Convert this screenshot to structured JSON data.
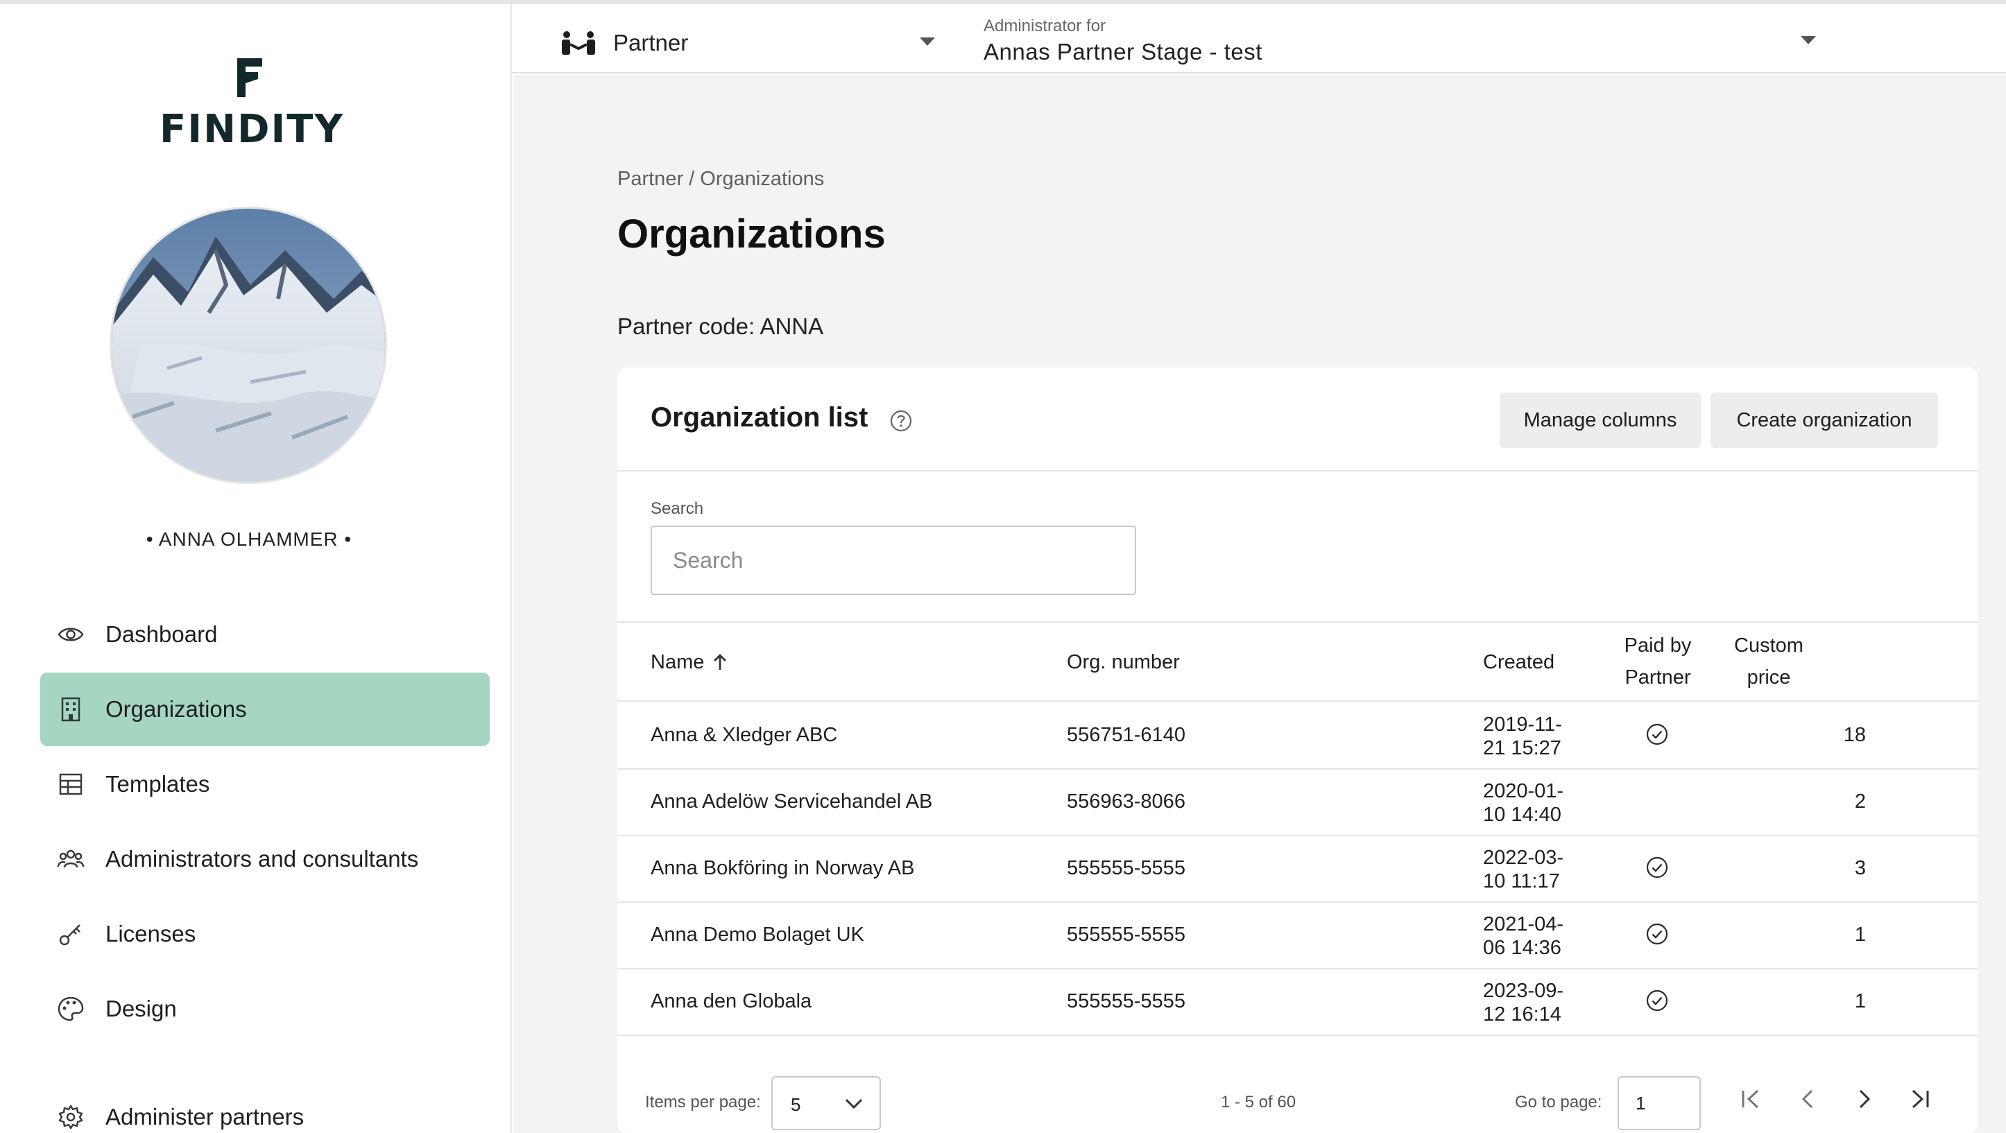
{
  "topbar": {
    "partner_label": "Partner",
    "admin_label": "Administrator for",
    "admin_value": "Annas Partner Stage - test"
  },
  "sidebar": {
    "logo_text": "FINDITY",
    "user_name": "• ANNA OLHAMMER •",
    "items": [
      {
        "label": "Dashboard",
        "icon": "eye-icon"
      },
      {
        "label": "Organizations",
        "icon": "building-icon",
        "active": true
      },
      {
        "label": "Templates",
        "icon": "table-icon"
      },
      {
        "label": "Administrators and consultants",
        "icon": "users-icon"
      },
      {
        "label": "Licenses",
        "icon": "key-icon"
      },
      {
        "label": "Design",
        "icon": "palette-icon"
      },
      {
        "label": "Administer partners",
        "icon": "gear-icon"
      }
    ],
    "active_color": "#a5d6c2"
  },
  "breadcrumb": {
    "root": "Partner",
    "separator": " / ",
    "current": "Organizations"
  },
  "page": {
    "title": "Organizations",
    "partner_code": "Partner code: ANNA"
  },
  "card": {
    "title": "Organization list",
    "manage_columns": "Manage columns",
    "create_organization": "Create organization",
    "search_label": "Search",
    "search_placeholder": "Search",
    "search_value": ""
  },
  "table": {
    "columns": {
      "name": "Name",
      "org_number": "Org. number",
      "created": "Created",
      "paid_by_partner_1": "Paid by",
      "paid_by_partner_2": "Partner",
      "custom_price_1": "Custom",
      "custom_price_2": "price"
    },
    "sort": {
      "column": "Name",
      "direction": "ascending"
    },
    "rows": [
      {
        "name": "Anna & Xledger ABC",
        "org": "556751-6140",
        "created_1": "2019-11-",
        "created_2": "21 15:27",
        "paid": true,
        "value": "18"
      },
      {
        "name": "Anna Adelöw Servicehandel AB",
        "org": "556963-8066",
        "created_1": "2020-01-",
        "created_2": "10 14:40",
        "paid": false,
        "value": "2"
      },
      {
        "name": "Anna Bokföring in Norway AB",
        "org": "555555-5555",
        "created_1": "2022-03-",
        "created_2": "10 11:17",
        "paid": true,
        "value": "3"
      },
      {
        "name": "Anna Demo Bolaget UK",
        "org": "555555-5555",
        "created_1": "2021-04-",
        "created_2": "06 14:36",
        "paid": true,
        "value": "1"
      },
      {
        "name": "Anna den Globala",
        "org": "555555-5555",
        "created_1": "2023-09-",
        "created_2": "12 16:14",
        "paid": true,
        "value": "1"
      }
    ]
  },
  "pagination": {
    "items_per_page_label": "Items per page:",
    "items_per_page": "5",
    "range": "1 - 5 of 60",
    "go_to_label": "Go to page:",
    "current_page": "1"
  }
}
